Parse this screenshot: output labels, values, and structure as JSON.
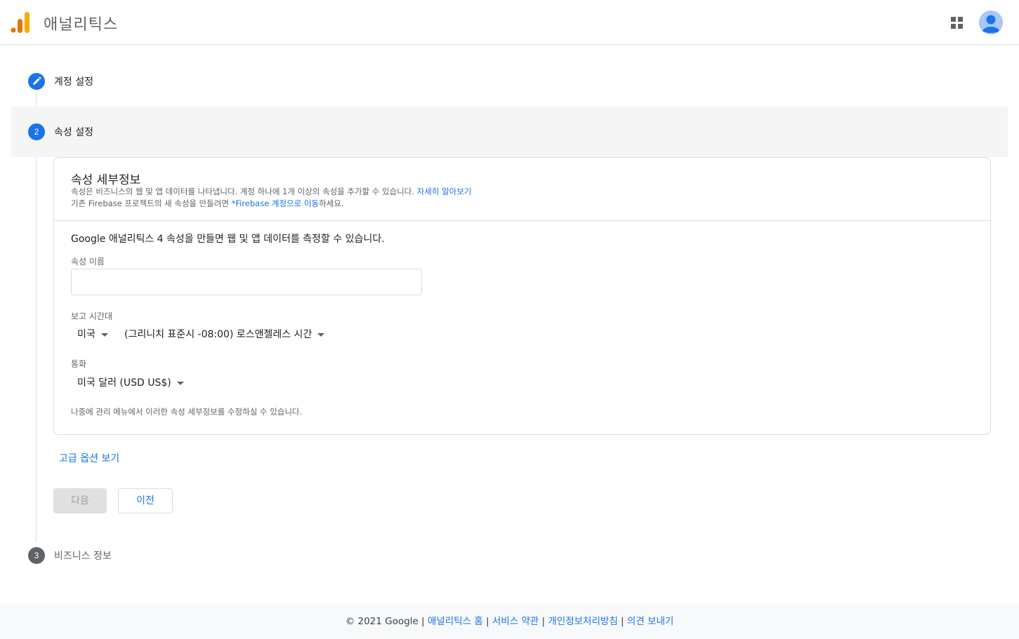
{
  "header": {
    "app_title": "애널리틱스"
  },
  "steps": [
    {
      "label": "계정 설정",
      "state": "done",
      "icon": "pencil-icon"
    },
    {
      "label": "속성 설정",
      "number": "2",
      "state": "active"
    },
    {
      "label": "비즈니스 정보",
      "number": "3",
      "state": "pending"
    }
  ],
  "card": {
    "title": "속성 세부정보",
    "desc1_text": "속성은 비즈니스의 웹 및 앱 데이터를 나타냅니다. 계정 하나에 1개 이상의 속성을 추가할 수 있습니다.",
    "desc1_link": "자세히 알아보기",
    "desc2_prefix": "기존 Firebase 프로젝트의 새 속성을 만들려면 ",
    "desc2_link": "*Firebase 계정으로 이동",
    "desc2_suffix": "하세요.",
    "intro": "Google 애널리틱스 4 속성을 만들면 웹 및 앱 데이터를 측정할 수 있습니다.",
    "property_name_label": "속성 이름",
    "property_name_value": "",
    "timezone_label": "보고 시간대",
    "country_value": "미국",
    "timezone_value": "(그리니치 표준시 -08:00) 로스앤젤레스 시간",
    "currency_label": "통화",
    "currency_value": "미국 달러 (USD US$)",
    "note": "나중에 관리 메뉴에서 이러한 속성 세부정보를 수정하실 수 있습니다."
  },
  "actions": {
    "advanced_options": "고급 옵션 보기",
    "next": "다음",
    "previous": "이전"
  },
  "footer": {
    "copyright": "© 2021 Google",
    "sep": " | ",
    "links": [
      "애널리틱스 홈",
      "서비스 약관",
      "개인정보처리방침",
      "의견 보내기"
    ]
  },
  "colors": {
    "accent": "#1a73e8",
    "logo_orange": "#f9ab00",
    "logo_dark": "#e37400",
    "step_pending": "#5f6368"
  }
}
